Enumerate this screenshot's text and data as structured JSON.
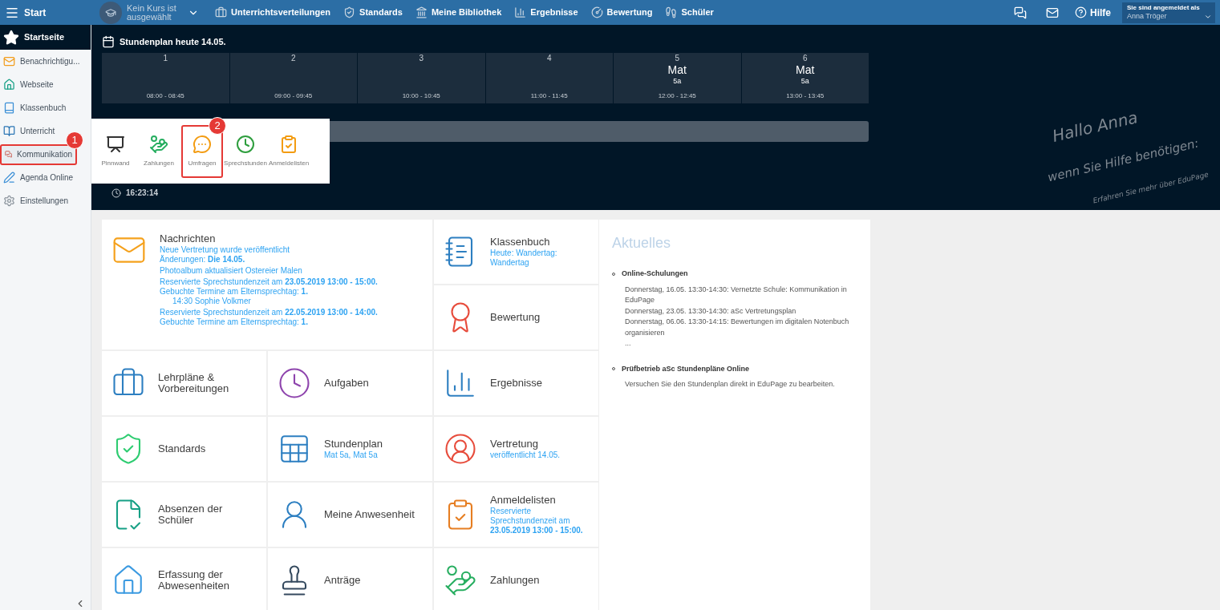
{
  "topbar": {
    "menu_label": "Start",
    "course": "Kein Kurs ist ausgewählt",
    "nav": [
      {
        "kind": "briefcase",
        "label": "Unterrichtsverteilungen"
      },
      {
        "kind": "shield",
        "label": "Standards"
      },
      {
        "kind": "library",
        "label": "Meine Bibliothek"
      },
      {
        "kind": "chart",
        "label": "Ergebnisse"
      },
      {
        "kind": "grade",
        "label": "Bewertung"
      },
      {
        "kind": "walk",
        "label": "Schüler"
      }
    ],
    "help": "Hilfe",
    "login_label": "Sie sind angemeldet als",
    "user": "Anna Tröger"
  },
  "sidebar": {
    "home": "Startseite",
    "items": [
      {
        "kind": "mail",
        "label": "Benachrichtigu...",
        "highlighted": false
      },
      {
        "kind": "house",
        "label": "Webseite",
        "highlighted": false
      },
      {
        "kind": "book",
        "label": "Klassenbuch",
        "highlighted": false
      },
      {
        "kind": "open-book",
        "label": "Unterricht",
        "highlighted": false
      },
      {
        "kind": "chat",
        "label": "Kommunikation",
        "highlighted": true,
        "badge": "1"
      },
      {
        "kind": "pen",
        "label": "Agenda Online",
        "highlighted": false
      },
      {
        "kind": "gear",
        "label": "Einstellungen",
        "highlighted": false
      }
    ]
  },
  "timetable": {
    "title": "Stundenplan heute 14.05.",
    "periods": [
      {
        "number": "1",
        "time": "08:00 - 08:45"
      },
      {
        "number": "2",
        "time": "09:00 - 09:45"
      },
      {
        "number": "3",
        "time": "10:00 - 10:45"
      },
      {
        "number": "4",
        "time": "11:00 - 11:45"
      },
      {
        "number": "5",
        "subject": "Mat",
        "class": "5a",
        "time": "12:00 - 12:45"
      },
      {
        "number": "6",
        "subject": "Mat",
        "class": "5a",
        "time": "13:00 - 13:45"
      }
    ]
  },
  "clock": "16:23:14",
  "popup": [
    {
      "kind": "easel",
      "label": "Pinnwand",
      "highlighted": false
    },
    {
      "kind": "money",
      "label": "Zahlungen",
      "highlighted": false
    },
    {
      "kind": "poll",
      "label": "Umfragen",
      "highlighted": true,
      "badge": "2"
    },
    {
      "kind": "clock",
      "label": "Sprechstunden",
      "highlighted": false
    },
    {
      "kind": "clipboard",
      "label": "Anmeldelisten",
      "highlighted": false
    }
  ],
  "help_note": [
    "Hallo Anna",
    "wenn Sie Hilfe benötigen:",
    "Erfahren Sie mehr über EduPage"
  ],
  "messages": {
    "kind": "mail",
    "title": "Nachrichten",
    "groups": [
      [
        {
          "text": "Neue Vertretung wurde veröffentlicht",
          "indented": false
        },
        {
          "text": "Änderungen: **Die 14.05.**",
          "indented": false
        }
      ],
      [
        {
          "text": "Photoalbum aktualisiert Ostereier Malen",
          "indented": false
        }
      ],
      [
        {
          "text": "Reservierte Sprechstundenzeit am **23.05.2019 13:00 - 15:00.**",
          "indented": false
        },
        {
          "text": "Gebuchte Termine am Elternsprechtag: **1.**",
          "indented": false
        },
        {
          "text": "14:30 Sophie Volkmer",
          "indented": true
        }
      ],
      [
        {
          "text": "Reservierte Sprechstundenzeit am **22.05.2019 13:00 - 14:00.**",
          "indented": false
        },
        {
          "text": "Gebuchte Termine am Elternsprechtag: **1.**",
          "indented": false
        }
      ]
    ]
  },
  "tiles": [
    {
      "kind": "notebook",
      "title": "Klassenbuch",
      "subtitle": "Heute: Wandertag: Wandertag"
    },
    {
      "kind": "grade",
      "title": "Bewertung"
    },
    {
      "kind": "briefcase",
      "title": "Lehrpläne & Vorbereitungen"
    },
    {
      "kind": "clock",
      "title": "Aufgaben"
    },
    {
      "kind": "chart",
      "title": "Ergebnisse"
    },
    {
      "kind": "shield",
      "title": "Standards"
    },
    {
      "kind": "table",
      "title": "Stundenplan",
      "subtitle": "Mat 5a, Mat 5a"
    },
    {
      "kind": "person",
      "title": "Vertretung",
      "subtitle": "veröffentlicht 14.05."
    },
    {
      "kind": "checklist",
      "title": "Absenzen der Schüler"
    },
    {
      "kind": "attendance",
      "title": "Meine Anwesenheit"
    },
    {
      "kind": "clipboard",
      "title": "Anmeldelisten",
      "subtitle": "Reservierte Sprechstundenzeit am **23.05.2019 13:00 - 15:00.**"
    },
    {
      "kind": "house",
      "title": "Erfassung der Abwesenheiten"
    },
    {
      "kind": "stamp",
      "title": "Anträge"
    },
    {
      "kind": "money",
      "title": "Zahlungen"
    }
  ],
  "news": {
    "title": "Aktuelles",
    "items": [
      {
        "heading": "Online-Schulungen",
        "lines": [
          "Donnerstag, 16.05. 13:30-14:30: Vernetzte Schule: Kommunikation in EduPage",
          "Donnerstag, 23.05. 13:30-14:30: aSc Vertretungsplan",
          "Donnerstag, 06.06. 13:30-14:15: Bewertungen im digitalen Notenbuch organisieren",
          "..."
        ]
      },
      {
        "heading": "Prüfbetrieb aSc Stundenpläne Online",
        "lines": [
          "Versuchen Sie den Stundenplan direkt in EduPage zu bearbeiten."
        ]
      }
    ]
  }
}
